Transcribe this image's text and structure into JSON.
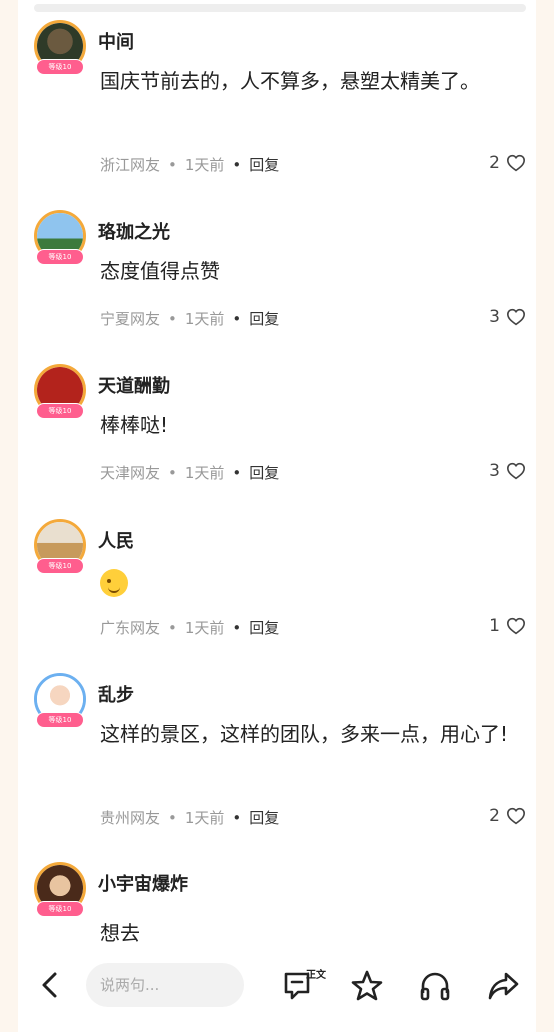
{
  "comments": [
    {
      "name": "中间",
      "badge": "等级10",
      "text": "国庆节前去的，人不算多，悬塑太精美了。",
      "location": "浙江网友",
      "time": "1天前",
      "reply": "回复",
      "likes": "2"
    },
    {
      "name": "珞珈之光",
      "badge": "等级10",
      "text": "态度值得点赞",
      "location": "宁夏网友",
      "time": "1天前",
      "reply": "回复",
      "likes": "3"
    },
    {
      "name": "天道酬勤",
      "badge": "等级10",
      "text": "棒棒哒!",
      "location": "天津网友",
      "time": "1天前",
      "reply": "回复",
      "likes": "3"
    },
    {
      "name": "人民",
      "badge": "等级10",
      "text": "",
      "emoji": "smile-emoji",
      "location": "广东网友",
      "time": "1天前",
      "reply": "回复",
      "likes": "1"
    },
    {
      "name": "乱步",
      "badge": "等级10",
      "text": "这样的景区，这样的团队，多来一点，用心了!",
      "location": "贵州网友",
      "time": "1天前",
      "reply": "回复",
      "likes": "2"
    },
    {
      "name": "小宇宙爆炸",
      "badge": "等级10",
      "text": "想去",
      "location": "",
      "time": "",
      "reply": "",
      "likes": ""
    }
  ],
  "bottom_bar": {
    "input_placeholder": "说两句...",
    "text_mode_label": "正文",
    "icons": [
      "back-arrow-icon",
      "comment-text-icon",
      "star-icon",
      "headphones-icon",
      "share-icon"
    ]
  },
  "colors": {
    "badge": "#ff5e8e",
    "avatar_ring": "#f4a93a"
  }
}
